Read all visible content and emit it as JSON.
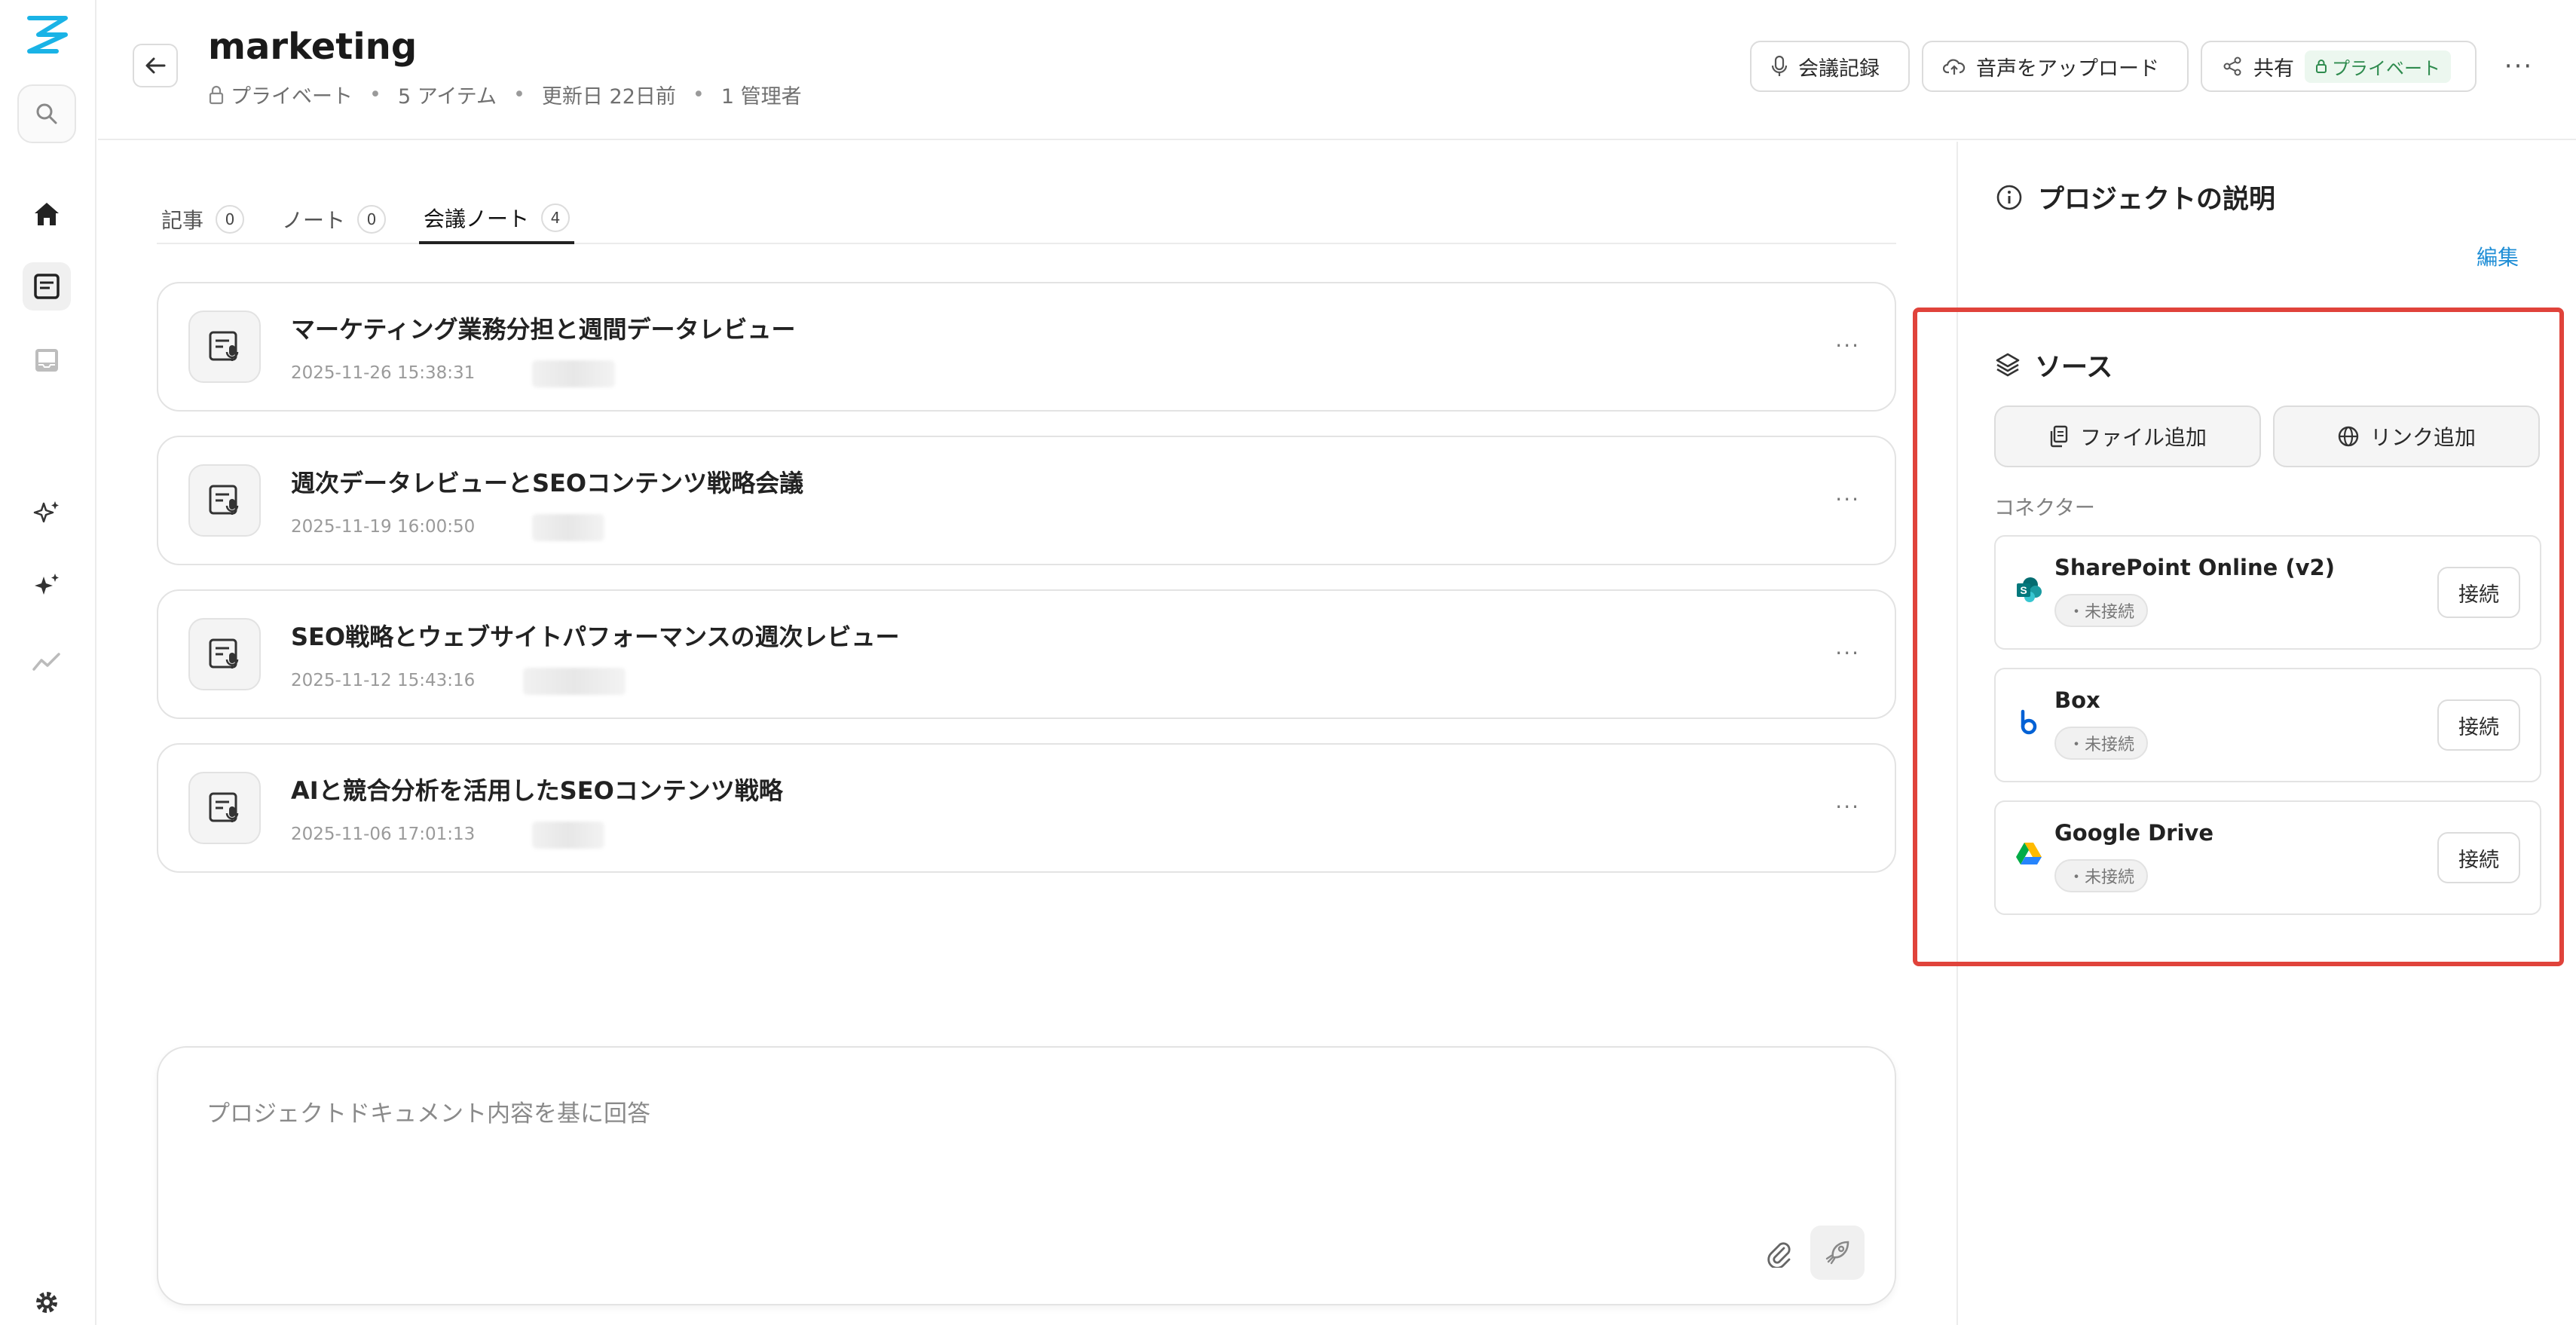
{
  "header": {
    "title": "marketing",
    "meta": {
      "visibility": "プライベート",
      "items": "5 アイテム",
      "updated": "更新日 22日前",
      "admins": "1 管理者",
      "separator": "•"
    },
    "buttons": {
      "record": "会議記録",
      "upload_audio": "音声をアップロード",
      "share": "共有",
      "share_badge": "プライベート",
      "more": "···"
    }
  },
  "tabs": [
    {
      "label": "記事",
      "count": "0"
    },
    {
      "label": "ノート",
      "count": "0"
    },
    {
      "label": "会議ノート",
      "count": "4"
    }
  ],
  "notes": [
    {
      "title": "マーケティング業務分担と週間データレビュー",
      "date": "2025-11-26 15:38:31"
    },
    {
      "title": "週次データレビューとSEOコンテンツ戦略会議",
      "date": "2025-11-19 16:00:50"
    },
    {
      "title": "SEO戦略とウェブサイトパフォーマンスの週次レビュー",
      "date": "2025-11-12 15:43:16"
    },
    {
      "title": "AIと競合分析を活用したSEOコンテンツ戦略",
      "date": "2025-11-06 17:01:13"
    }
  ],
  "card_more": "···",
  "chat": {
    "placeholder": "プロジェクトドキュメント内容を基に回答"
  },
  "right_panel": {
    "description_title": "プロジェクトの説明",
    "edit": "編集",
    "sources_title": "ソース",
    "add_file": "ファイル追加",
    "add_link": "リンク追加",
    "connectors_label": "コネクター",
    "connectors": [
      {
        "name": "SharePoint Online (v2)",
        "status": "・未接続",
        "action": "接続",
        "icon": "sharepoint-icon"
      },
      {
        "name": "Box",
        "status": "・未接続",
        "action": "接続",
        "icon": "box-icon"
      },
      {
        "name": "Google Drive",
        "status": "・未接続",
        "action": "接続",
        "icon": "google-drive-icon"
      }
    ]
  },
  "colors": {
    "accent_logo": "#1ab3e6",
    "highlight": "#e0433b",
    "link": "#1f8ed6",
    "private_badge": "#2e8b4e"
  }
}
